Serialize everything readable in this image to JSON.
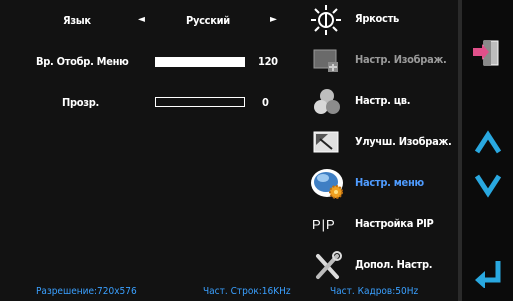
{
  "settings": {
    "language": {
      "label": "Язык",
      "value": "Русский",
      "prev_glyph": "◄",
      "next_glyph": "►"
    },
    "menu_time": {
      "label": "Вр. Отобр. Меню",
      "value": "120",
      "fraction": 1.0
    },
    "transparency": {
      "label": "Прозр.",
      "value": "0",
      "fraction": 0.0
    }
  },
  "menu": {
    "items": [
      {
        "label": "Яркость",
        "icon": "brightness-icon",
        "state": "normal"
      },
      {
        "label": "Настр. Изображ.",
        "icon": "image-settings-icon",
        "state": "dim"
      },
      {
        "label": "Настр. цв.",
        "icon": "color-settings-icon",
        "state": "normal"
      },
      {
        "label": "Улучш. Изображ.",
        "icon": "image-enhance-icon",
        "state": "normal"
      },
      {
        "label": "Настр. меню",
        "icon": "menu-settings-icon",
        "state": "active"
      },
      {
        "label": "Настройка PIP",
        "icon": "pip-icon",
        "icon_text": "P|P",
        "state": "normal"
      },
      {
        "label": "Допол. Настр.",
        "icon": "tools-icon",
        "state": "normal"
      }
    ]
  },
  "status": {
    "resolution": "Разрешение:720x576",
    "h_freq": "Част. Строк:16KHz",
    "v_freq": "Част. Кадров:50Hz"
  },
  "colors": {
    "active_text": "#4f9cff",
    "status_text": "#3aa0ff",
    "nav_arrows": "#29a8e0",
    "exit_icon": "#e0508a"
  }
}
